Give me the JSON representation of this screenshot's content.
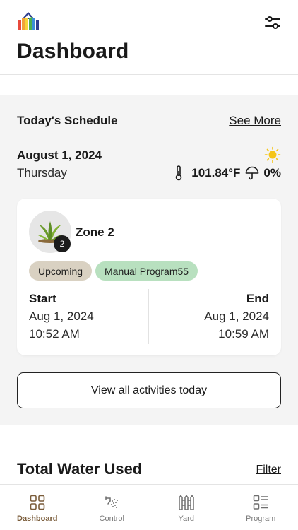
{
  "header": {
    "title": "Dashboard",
    "logo_icon": "house-logo-icon",
    "settings_icon": "sliders-icon"
  },
  "schedule": {
    "title": "Today's Schedule",
    "see_more": "See More",
    "date": "August 1, 2024",
    "day": "Thursday",
    "weather": {
      "icon": "sun-icon",
      "temperature": "101.84°F",
      "rain_chance": "0%"
    },
    "zone": {
      "name": "Zone 2",
      "number": "2",
      "status": "Upcoming",
      "program": "Manual Program55",
      "start_label": "Start",
      "start_date": "Aug 1, 2024",
      "start_time": "10:52 AM",
      "end_label": "End",
      "end_date": "Aug 1, 2024",
      "end_time": "10:59 AM"
    },
    "view_all": "View all activities today"
  },
  "water": {
    "title": "Total Water Used",
    "filter": "Filter"
  },
  "nav": {
    "items": [
      {
        "label": "Dashboard",
        "icon": "grid-icon",
        "active": true
      },
      {
        "label": "Control",
        "icon": "sprinkler-icon",
        "active": false
      },
      {
        "label": "Yard",
        "icon": "fence-icon",
        "active": false
      },
      {
        "label": "Program",
        "icon": "list-icon",
        "active": false
      }
    ]
  },
  "colors": {
    "accent_brown": "#7a5c3a",
    "status_tag": "#d9d1c2",
    "program_tag": "#b8e0bf",
    "section_bg": "#f4f4f4",
    "sun": "#f5c518"
  }
}
